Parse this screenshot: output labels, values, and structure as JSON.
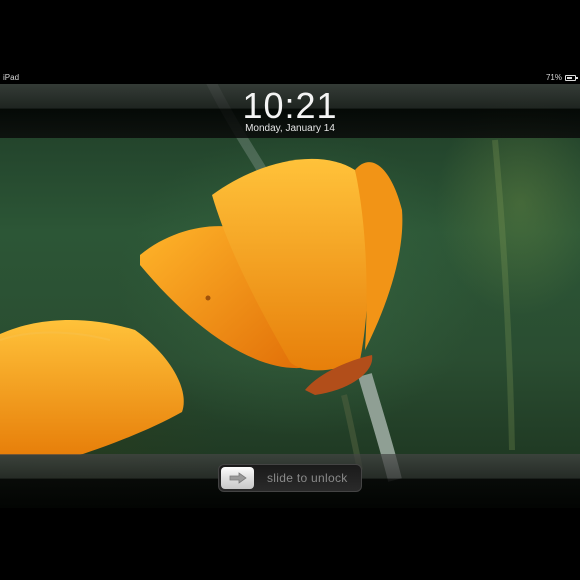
{
  "status_bar": {
    "carrier": "iPad",
    "battery_text": "71%",
    "battery_level": 0.71
  },
  "clock": {
    "time": "10:21",
    "date": "Monday, January 14"
  },
  "unlock": {
    "label": "slide to unlock",
    "knob_icon": "arrow-right-icon"
  },
  "wallpaper": {
    "subject": "orange-poppy-flower",
    "colors": {
      "petal": "#f7a21a",
      "background": "#2c5636"
    }
  }
}
